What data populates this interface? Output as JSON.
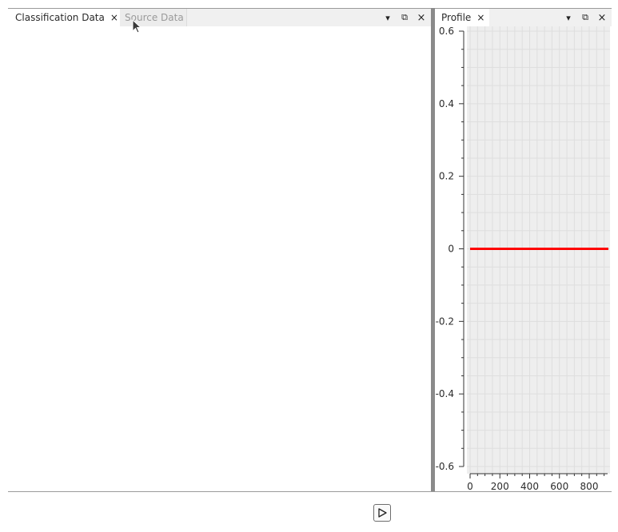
{
  "left_dock": {
    "tabs": [
      {
        "label": "Classification Data",
        "close_glyph": "×",
        "active": true
      },
      {
        "label": "Source Data",
        "active": false
      }
    ],
    "controls": {
      "menu": "▾",
      "float": "⧉",
      "close": "×"
    }
  },
  "right_dock": {
    "tab": {
      "label": "Profile",
      "close_glyph": "×"
    },
    "controls": {
      "menu": "▾",
      "float": "⧉",
      "close": "×"
    }
  },
  "chart_data": {
    "type": "line",
    "title": "",
    "xlabel": "",
    "ylabel": "",
    "xlim": [
      -10,
      940
    ],
    "ylim": [
      -0.6,
      0.6
    ],
    "x_ticks": [
      0,
      200,
      400,
      600,
      800
    ],
    "y_ticks": [
      0.6,
      0.4,
      0.2,
      0,
      -0.2,
      -0.4,
      -0.6
    ],
    "x_tick_labels": [
      "0",
      "200",
      "400",
      "600",
      "800"
    ],
    "y_tick_labels": [
      "0.6",
      "0.4",
      "0.2",
      "0",
      "-0.2",
      "-0.4",
      "-0.6"
    ],
    "grid": true,
    "background": "#eeeeee",
    "series": [
      {
        "color": "#ff0000",
        "x": [
          0,
          940
        ],
        "y": [
          0,
          0
        ]
      }
    ]
  },
  "controls": {
    "play_icon": "play-icon"
  }
}
